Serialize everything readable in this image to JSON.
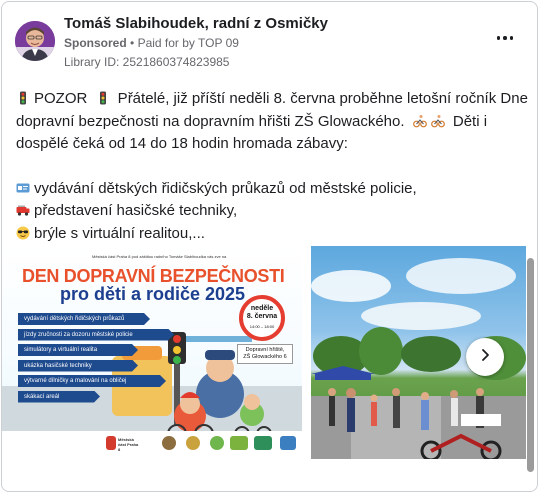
{
  "post": {
    "author": "Tomáš Slabihoudek, radní z Osmičky",
    "sponsored": "Sponsored",
    "separator": "•",
    "paid_for": "Paid for by TOP 09",
    "library_id": "Library ID: 2521860374823985",
    "more_icon": "more-horizontal-icon"
  },
  "body": {
    "line1": "POZOR",
    "line1_rest": " Přátelé, již příští neděli 8. června proběhne letošní ročník Dne dopravní bezpečnosti na dopravním hřišti ZŠ Glowackého.",
    "line1_tail": " Děti i dospělé čeká od 14 do 18 hodin hromada zábavy:",
    "bullets": [
      "vydávání dětských řidičských průkazů od městské policie,",
      "představení hasičské techniky,",
      "brýle s virtuální realitou,..."
    ]
  },
  "slide1": {
    "small_text": "Městská část Praha 8 pod záštitou radního Tomáše Slabihoudka vás zve na",
    "title_line1": "DEN DOPRAVNÍ BEZPEČNOSTI",
    "title_line2": "pro děti a rodiče 2025",
    "badge_line1": "neděle",
    "badge_line2": "8. června",
    "badge_time": "14:00 – 18:00",
    "location_line1": "Dopravní hřiště,",
    "location_line2": "ZŠ Glowackého 6",
    "items": [
      "vydávání dětských řidičských průkazů",
      "jízdy zručnosti za dozoru městské policie",
      "simulátory a virtuální realita",
      "ukázka hasičské techniky",
      "výtvarné dílničky a malování na obličej",
      "skákací areál"
    ],
    "logo_text": "Městská část Praha 8"
  },
  "carousel": {
    "next_icon": "chevron-right-icon"
  },
  "colors": {
    "title_orange": "#e8512b",
    "title_blue": "#1d3f8f",
    "item_blue": "#1e4a8e"
  }
}
